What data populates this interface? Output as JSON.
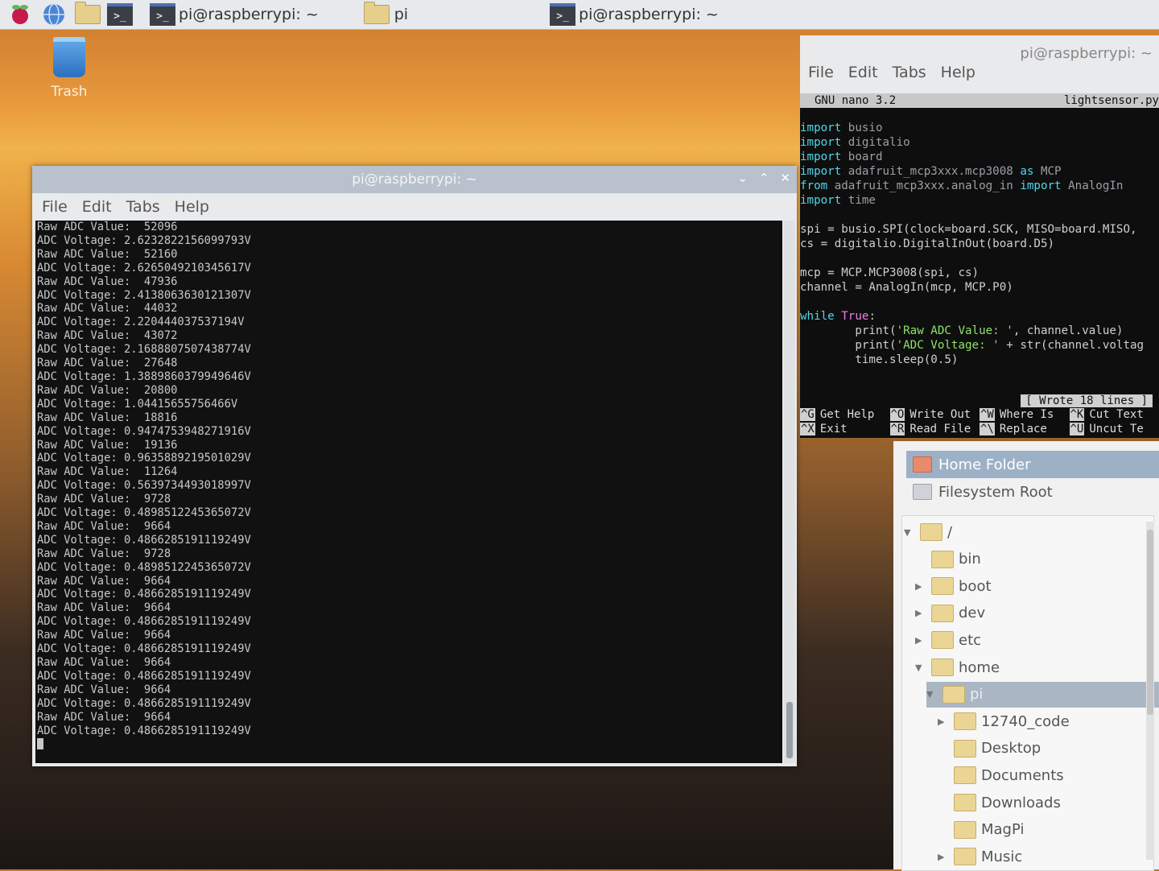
{
  "taskbar": {
    "tasks": [
      {
        "label": "pi@raspberrypi: ~",
        "kind": "terminal"
      },
      {
        "label": "pi",
        "kind": "folder"
      },
      {
        "label": "pi@raspberrypi: ~",
        "kind": "terminal"
      }
    ]
  },
  "desktop": {
    "trash_label": "Trash"
  },
  "terminal_left": {
    "title": "pi@raspberrypi: ~",
    "menu": [
      "File",
      "Edit",
      "Tabs",
      "Help"
    ],
    "lines": [
      "Raw ADC Value:  52096",
      "ADC Voltage: 2.6232822156099793V",
      "Raw ADC Value:  52160",
      "ADC Voltage: 2.6265049210345617V",
      "Raw ADC Value:  47936",
      "ADC Voltage: 2.4138063630121307V",
      "Raw ADC Value:  44032",
      "ADC Voltage: 2.220444037537194V",
      "Raw ADC Value:  43072",
      "ADC Voltage: 2.1688807507438774V",
      "Raw ADC Value:  27648",
      "ADC Voltage: 1.3889860379949646V",
      "Raw ADC Value:  20800",
      "ADC Voltage: 1.04415655756466V",
      "Raw ADC Value:  18816",
      "ADC Voltage: 0.9474753948271916V",
      "Raw ADC Value:  19136",
      "ADC Voltage: 0.9635889219501029V",
      "Raw ADC Value:  11264",
      "ADC Voltage: 0.5639734493018997V",
      "Raw ADC Value:  9728",
      "ADC Voltage: 0.4898512245365072V",
      "Raw ADC Value:  9664",
      "ADC Voltage: 0.4866285191119249V",
      "Raw ADC Value:  9728",
      "ADC Voltage: 0.4898512245365072V",
      "Raw ADC Value:  9664",
      "ADC Voltage: 0.4866285191119249V",
      "Raw ADC Value:  9664",
      "ADC Voltage: 0.4866285191119249V",
      "Raw ADC Value:  9664",
      "ADC Voltage: 0.4866285191119249V",
      "Raw ADC Value:  9664",
      "ADC Voltage: 0.4866285191119249V",
      "Raw ADC Value:  9664",
      "ADC Voltage: 0.4866285191119249V",
      "Raw ADC Value:  9664",
      "ADC Voltage: 0.4866285191119249V"
    ]
  },
  "terminal_right": {
    "title": "pi@raspberrypi: ~",
    "menu": [
      "File",
      "Edit",
      "Tabs",
      "Help"
    ],
    "nano_version": "GNU nano 3.2",
    "filename": "lightsensor.py",
    "status": "[ Wrote 18 lines ]",
    "code": {
      "l1_kw": "import",
      "l1_rest": " busio",
      "l2_kw": "import",
      "l2_rest": " digitalio",
      "l3_kw": "import",
      "l3_rest": " board",
      "l4_kw": "import",
      "l4_rest": " adafruit_mcp3xxx.mcp3008 ",
      "l4_as": "as",
      "l4_tail": " MCP",
      "l5_kw": "from",
      "l5_rest": " adafruit_mcp3xxx.analog_in ",
      "l5_imp": "import",
      "l5_tail": " AnalogIn",
      "l6_kw": "import",
      "l6_rest": " time",
      "l8": "spi = busio.SPI(clock=board.SCK, MISO=board.MISO,",
      "l9": "cs = digitalio.DigitalInOut(board.D5)",
      "l11": "mcp = MCP.MCP3008(spi, cs)",
      "l12": "channel = AnalogIn(mcp, MCP.P0)",
      "l14_kw": "while",
      "l14_true": "True",
      "l14_tail": ":",
      "l15_pre": "        print(",
      "l15_str": "'Raw ADC Value: '",
      "l15_tail": ", channel.value)",
      "l16_pre": "        print(",
      "l16_str": "'ADC Voltage: '",
      "l16_tail": " + str(channel.voltag",
      "l17": "        time.sleep(0.5)"
    },
    "shortcuts": [
      [
        {
          "key": "^G",
          "label": "Get Help"
        },
        {
          "key": "^O",
          "label": "Write Out"
        },
        {
          "key": "^W",
          "label": "Where Is"
        },
        {
          "key": "^K",
          "label": "Cut Text"
        }
      ],
      [
        {
          "key": "^X",
          "label": "Exit"
        },
        {
          "key": "^R",
          "label": "Read File"
        },
        {
          "key": "^\\",
          "label": "Replace"
        },
        {
          "key": "^U",
          "label": "Uncut Te"
        }
      ]
    ]
  },
  "file_manager": {
    "places": [
      {
        "label": "Home Folder",
        "selected": true
      },
      {
        "label": "Filesystem Root",
        "selected": false
      }
    ],
    "tree": [
      {
        "label": "/",
        "indent": 0,
        "arrow": "down"
      },
      {
        "label": "bin",
        "indent": 1,
        "arrow": ""
      },
      {
        "label": "boot",
        "indent": 1,
        "arrow": "right"
      },
      {
        "label": "dev",
        "indent": 1,
        "arrow": "right"
      },
      {
        "label": "etc",
        "indent": 1,
        "arrow": "right"
      },
      {
        "label": "home",
        "indent": 1,
        "arrow": "down"
      },
      {
        "label": "pi",
        "indent": 2,
        "arrow": "down",
        "selected": true
      },
      {
        "label": "12740_code",
        "indent": 3,
        "arrow": "right"
      },
      {
        "label": "Desktop",
        "indent": 3,
        "arrow": ""
      },
      {
        "label": "Documents",
        "indent": 3,
        "arrow": ""
      },
      {
        "label": "Downloads",
        "indent": 3,
        "arrow": ""
      },
      {
        "label": "MagPi",
        "indent": 3,
        "arrow": ""
      },
      {
        "label": "Music",
        "indent": 3,
        "arrow": "right"
      }
    ]
  }
}
